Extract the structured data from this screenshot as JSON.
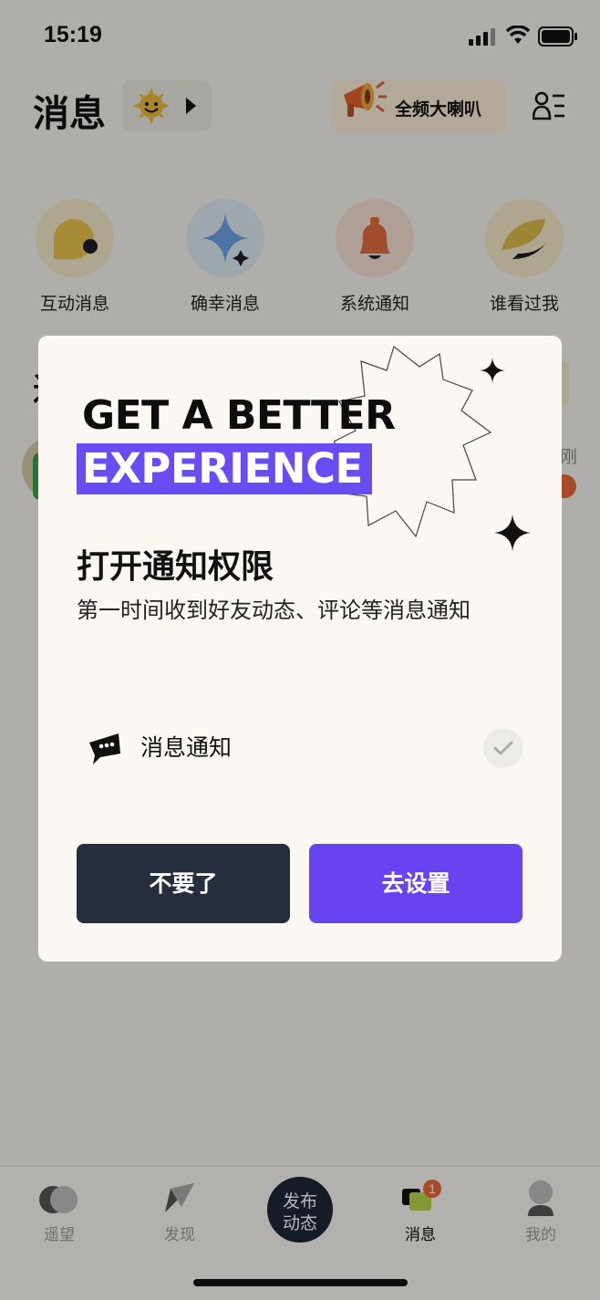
{
  "status_bar": {
    "time": "15:19"
  },
  "header": {
    "title": "消息",
    "broadcast_label": "全频大喇叭"
  },
  "categories": [
    {
      "label": "互动消息",
      "color": "#e7c44a"
    },
    {
      "label": "确幸消息",
      "color": "#6aa0e0"
    },
    {
      "label": "系统通知",
      "color": "#e06a3e"
    },
    {
      "label": "谁看过我",
      "color": "#d9b94a"
    }
  ],
  "background": {
    "partial_title": "近",
    "partial_name": "刚"
  },
  "modal": {
    "hero_line1": "GET A BETTER",
    "hero_line2": "EXPERIENCE",
    "title": "打开通知权限",
    "description": "第一时间收到好友动态、评论等消息通知",
    "permission_label": "消息通知",
    "decline_label": "不要了",
    "confirm_label": "去设置",
    "accent_color": "#6744f0"
  },
  "tabbar": {
    "tabs": [
      {
        "label": "遥望"
      },
      {
        "label": "发现"
      },
      {
        "label": "消息",
        "badge": "1"
      },
      {
        "label": "我的"
      }
    ],
    "post_label_line1": "发布",
    "post_label_line2": "动态"
  }
}
